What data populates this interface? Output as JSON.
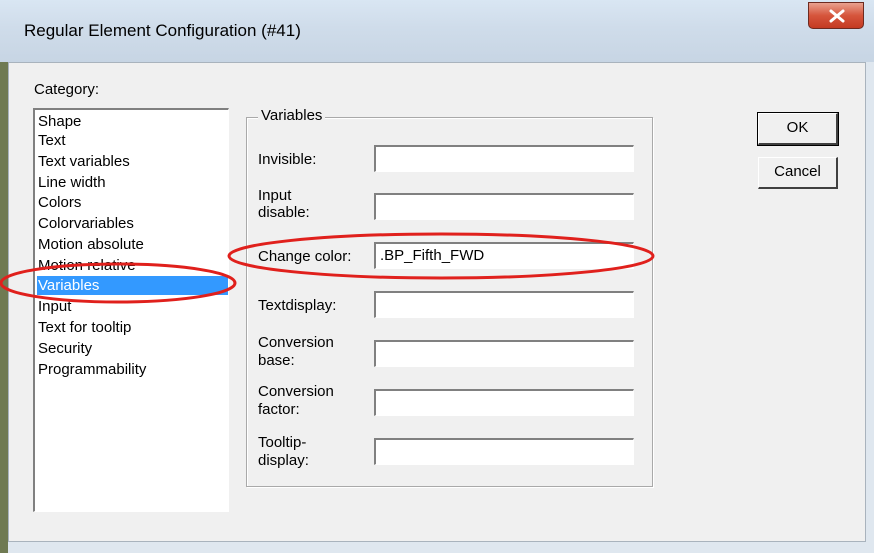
{
  "window": {
    "title": "Regular Element Configuration (#41)"
  },
  "category": {
    "label": "Category:",
    "items": [
      "Shape",
      "Text",
      "Text variables",
      "Line width",
      "Colors",
      "Colorvariables",
      "Motion absolute",
      "Motion relative",
      "Variables",
      "Input",
      "Text for tooltip",
      "Security",
      "Programmability"
    ],
    "selected": "Variables"
  },
  "variables": {
    "group_title": "Variables",
    "fields": [
      {
        "label_lines": [
          "Invisible:"
        ],
        "value": ""
      },
      {
        "label_lines": [
          "Input",
          "disable:"
        ],
        "value": ""
      },
      {
        "label_lines": [
          "Change color:"
        ],
        "value": ".BP_Fifth_FWD"
      },
      {
        "label_lines": [
          "Textdisplay:"
        ],
        "value": ""
      },
      {
        "label_lines": [
          "Conversion",
          "base:"
        ],
        "value": ""
      },
      {
        "label_lines": [
          "Conversion",
          "factor:"
        ],
        "value": ""
      },
      {
        "label_lines": [
          "Tooltip-",
          "display:"
        ],
        "value": ""
      }
    ]
  },
  "buttons": {
    "ok": "OK",
    "cancel": "Cancel"
  },
  "colors": {
    "selection": "#3399ff",
    "annotation": "#e0201c",
    "close": "#c43a22"
  }
}
